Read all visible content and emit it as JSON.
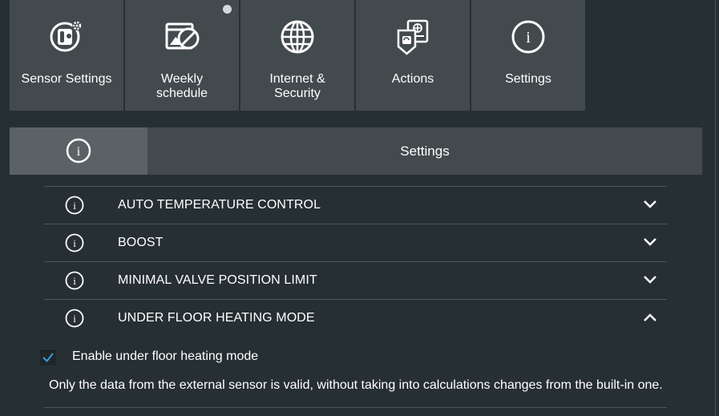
{
  "tiles": [
    {
      "label": "Sensor Settings",
      "icon": "sensor-settings-icon"
    },
    {
      "label_line1": "Weekly",
      "label_line2": "schedule",
      "icon": "weekly-schedule-off-icon",
      "has_notification_dot": true
    },
    {
      "label_line1": "Internet &",
      "label_line2": "Security",
      "icon": "globe-icon"
    },
    {
      "label": "Actions",
      "icon": "actions-icon"
    },
    {
      "label": "Settings",
      "icon": "info-icon"
    }
  ],
  "section": {
    "title": "Settings",
    "icon": "info-icon"
  },
  "accordion": [
    {
      "label": "AUTO TEMPERATURE CONTROL",
      "expanded": false
    },
    {
      "label": "BOOST",
      "expanded": false
    },
    {
      "label": "MINIMAL VALVE POSITION LIMIT",
      "expanded": false
    },
    {
      "label": "UNDER FLOOR HEATING MODE",
      "expanded": true
    }
  ],
  "underfloor": {
    "checkbox_label": "Enable under floor heating mode",
    "checked": true,
    "description": "Only the data from the external sensor is valid, without taking into calculations changes from the built-in one."
  },
  "colors": {
    "background": "#262f33",
    "tile": "#434a4e",
    "accent_check": "#3a9ad9"
  }
}
